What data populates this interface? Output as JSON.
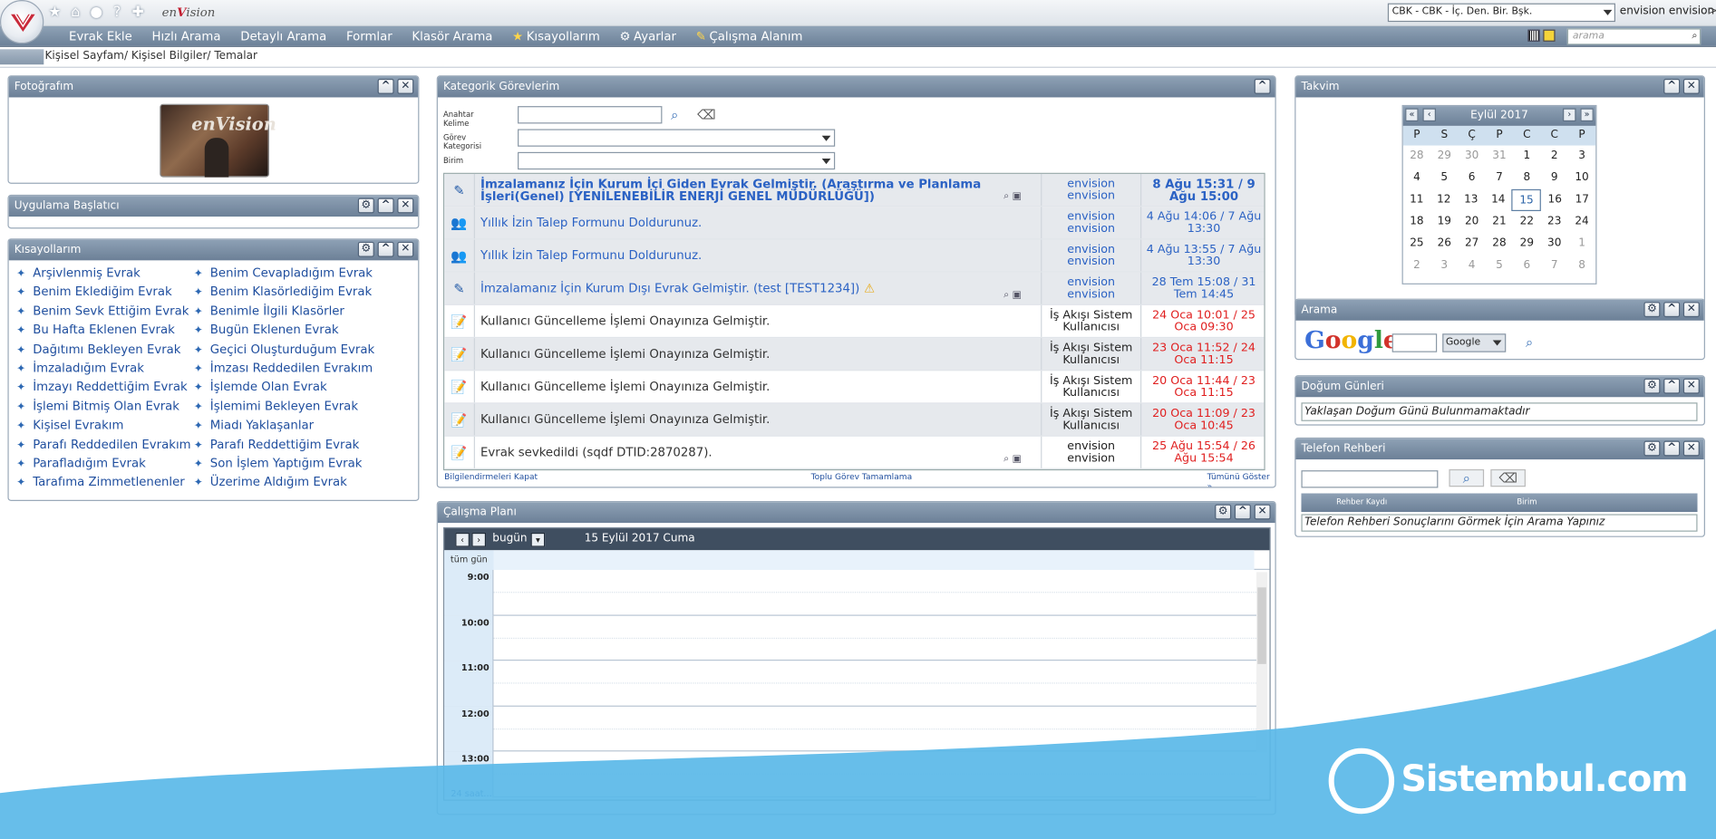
{
  "app": {
    "brand_a": "en",
    "brand_b": "V",
    "brand_c": "ision"
  },
  "top": {
    "unit_select": "CBK - CBK - İç. Den. Bir. Bşk.",
    "user": "envision envision",
    "close": ">",
    "search_placeholder": "arama"
  },
  "menu": {
    "items": [
      "Evrak Ekle",
      "Hızlı Arama",
      "Detaylı Arama",
      "Formlar",
      "Klasör Arama",
      "Kısayollarım",
      "Ayarlar",
      "Çalışma Alanım"
    ]
  },
  "breadcrumb": "Kişisel Sayfam/ Kişisel Bilgiler/ Temalar",
  "panels": {
    "photo": "Fotoğrafım",
    "launcher": "Uygulama Başlatıcı",
    "shortcuts": "Kısayollarım",
    "tasks": "Kategorik Görevlerim",
    "plan": "Çalışma Planı",
    "calendar": "Takvim",
    "search": "Arama",
    "birthdays": "Doğum Günleri",
    "phonebook": "Telefon Rehberi"
  },
  "shortcuts": {
    "col1": [
      "Arşivlenmiş Evrak",
      "Benim Eklediğim Evrak",
      "Benim Sevk Ettiğim Evrak",
      "Bu Hafta Eklenen Evrak",
      "Dağıtımı Bekleyen Evrak",
      "İmzaladığım Evrak",
      "İmzayı Reddettiğim Evrak",
      "İşlemi Bitmiş Olan Evrak",
      "Kişisel Evrakım",
      "Parafı Reddedilen Evrakım",
      "Parafladığım Evrak",
      "Tarafıma Zimmetlenenler"
    ],
    "col2": [
      "Benim Cevapladığım Evrak",
      "Benim Klasörlediğim Evrak",
      "Benimle İlgili Klasörler",
      "Bugün Eklenen Evrak",
      "Geçici Oluşturduğum Evrak",
      "İmzası Reddedilen Evrakım",
      "İşlemde Olan Evrak",
      "İşlemimi Bekleyen Evrak",
      "Miadı Yaklaşanlar",
      "Parafı Reddettiğim Evrak",
      "Son İşlem Yaptığım Evrak",
      "Üzerime Aldığım Evrak"
    ]
  },
  "task_form": {
    "keyword": "Anahtar Kelime",
    "category": "Görev Kategorisi",
    "unit": "Birim"
  },
  "tasks": [
    {
      "text": "İmzalamanız İçin Kurum İçi Giden Evrak Gelmiştir. (Araştırma ve Planlama İşleri(Genel) [YENİLENEBİLİR ENERJİ GENEL MÜDÜRLÜĞÜ])",
      "sender": "envision envision",
      "date": "8 Ağu 15:31 / 9 Ağu 15:00",
      "icon": "edit-icon",
      "gray": true,
      "bold": true,
      "red": false,
      "actions": true
    },
    {
      "text": "Yıllık İzin Talep Formunu Doldurunuz.",
      "sender": "envision envision",
      "date": "4 Ağu 14:06 / 7 Ağu 13:30",
      "icon": "group-icon",
      "gray": true,
      "bold": false,
      "red": false,
      "actions": false
    },
    {
      "text": "Yıllık İzin Talep Formunu Doldurunuz.",
      "sender": "envision envision",
      "date": "4 Ağu 13:55 / 7 Ağu 13:30",
      "icon": "group-icon",
      "gray": true,
      "bold": false,
      "red": false,
      "actions": false
    },
    {
      "text": "İmzalamanız İçin Kurum Dışı Evrak Gelmiştir. (test [TEST1234])",
      "sender": "envision envision",
      "date": "28 Tem 15:08 / 31 Tem 14:45",
      "icon": "edit-icon",
      "gray": true,
      "bold": false,
      "red": false,
      "actions": true,
      "warn": true
    },
    {
      "text": "Kullanıcı Güncelleme İşlemi Onayınıza Gelmiştir.",
      "sender": "İş Akışı Sistem Kullanıcısı",
      "date": "24 Oca 10:01 / 25 Oca 09:30",
      "icon": "form-icon",
      "gray": false,
      "bold": false,
      "red": true,
      "actions": false
    },
    {
      "text": "Kullanıcı Güncelleme İşlemi Onayınıza Gelmiştir.",
      "sender": "İş Akışı Sistem Kullanıcısı",
      "date": "23 Oca 11:52 / 24 Oca 11:15",
      "icon": "form-icon",
      "gray": true,
      "bold": false,
      "red": true,
      "actions": false
    },
    {
      "text": "Kullanıcı Güncelleme İşlemi Onayınıza Gelmiştir.",
      "sender": "İş Akışı Sistem Kullanıcısı",
      "date": "20 Oca 11:44 / 23 Oca 11:15",
      "icon": "form-icon",
      "gray": false,
      "bold": false,
      "red": true,
      "actions": false
    },
    {
      "text": "Kullanıcı Güncelleme İşlemi Onayınıza Gelmiştir.",
      "sender": "İş Akışı Sistem Kullanıcısı",
      "date": "20 Oca 11:09 / 23 Oca 10:45",
      "icon": "form-icon",
      "gray": true,
      "bold": false,
      "red": true,
      "actions": false
    },
    {
      "text": "Evrak sevkedildi (sqdf DTID:2870287).",
      "sender": "envision envision",
      "date": "25 Ağu 15:54 / 26 Ağu 15:54",
      "icon": "form-icon",
      "gray": false,
      "bold": false,
      "red": true,
      "actions": true,
      "darktext": true
    }
  ],
  "task_footer": {
    "close_notifs": "Bilgilendirmeleri Kapat",
    "bulk_complete": "Toplu Görev Tamamlama",
    "show_all": "Tümünü Göster »"
  },
  "plan": {
    "today": "bugün",
    "date": "15 Eylül 2017 Cuma",
    "allday": "tüm gün",
    "hours": [
      "9:00",
      "10:00",
      "11:00",
      "12:00",
      "13:00"
    ],
    "footer": "24 saat..."
  },
  "calendar": {
    "month": "Eylül 2017",
    "weekdays": [
      "P",
      "S",
      "Ç",
      "P",
      "C",
      "C",
      "P"
    ],
    "weeks": [
      [
        "28",
        "29",
        "30",
        "31",
        "1",
        "2",
        "3"
      ],
      [
        "4",
        "5",
        "6",
        "7",
        "8",
        "9",
        "10"
      ],
      [
        "11",
        "12",
        "13",
        "14",
        "15",
        "16",
        "17"
      ],
      [
        "18",
        "19",
        "20",
        "21",
        "22",
        "23",
        "24"
      ],
      [
        "25",
        "26",
        "27",
        "28",
        "29",
        "30",
        "1"
      ],
      [
        "2",
        "3",
        "4",
        "5",
        "6",
        "7",
        "8"
      ]
    ],
    "today": "15"
  },
  "search": {
    "engine": "Google",
    "select": "Google"
  },
  "birthdays": {
    "message": "Yaklaşan Doğum Günü Bulunmamaktadır"
  },
  "phonebook": {
    "col1": "Rehber Kaydı",
    "col2": "Birim",
    "message": "Telefon Rehberi Sonuçlarını Görmek İçin Arama Yapınız"
  },
  "watermark": "Sistembul.com",
  "colors": {
    "header": "#7a8ea4",
    "link": "#1f4e9e",
    "red": "#e02020",
    "wave": "#5ab8e8"
  }
}
